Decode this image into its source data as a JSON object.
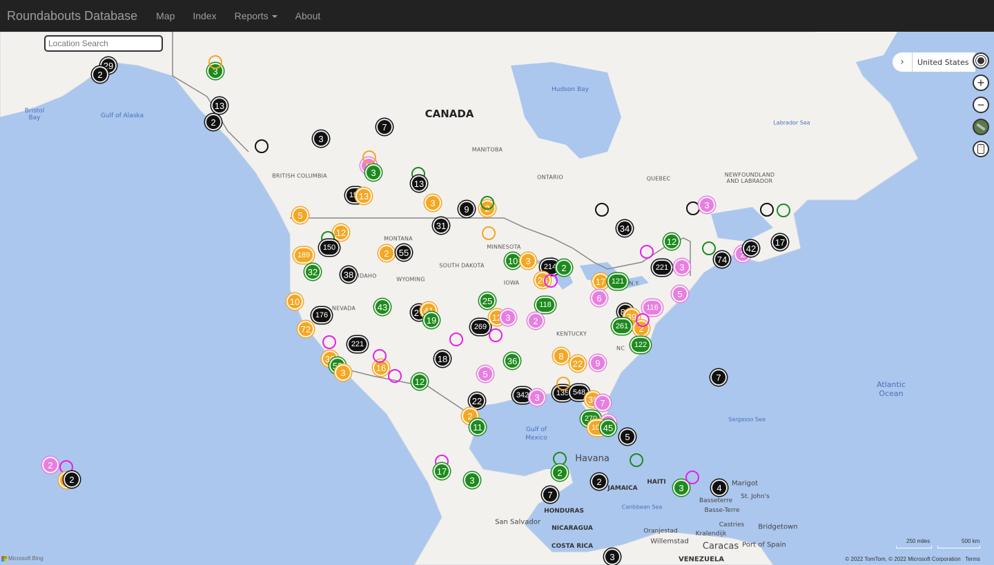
{
  "navbar": {
    "brand": "Roundabouts Database",
    "items": [
      {
        "label": "Map"
      },
      {
        "label": "Index"
      },
      {
        "label": "Reports",
        "has_dropdown": true
      },
      {
        "label": "About"
      }
    ]
  },
  "search": {
    "placeholder": "Location Search",
    "value": ""
  },
  "map_controls": {
    "location_label": "United States",
    "expand_icon": "chevron-right-icon",
    "buttons": [
      "locate-me-icon",
      "zoom-in-icon",
      "zoom-out-icon",
      "map-style-icon",
      "traffic-icon"
    ]
  },
  "map_labels": {
    "countries": [
      "CANADA"
    ],
    "regions": [
      "BRITISH COLUMBIA",
      "MANITOBA",
      "ONTARIO",
      "QUEBEC",
      "NEWFOUNDLAND AND LABRADOR",
      "MONTANA",
      "MINNESOTA",
      "SOUTH DAKOTA",
      "IDAHO",
      "WYOMING",
      "IOWA",
      "NEVADA",
      "KENTUCKY",
      "N.Y.",
      "NC"
    ],
    "water": [
      "Hudson Bay",
      "Gulf of Alaska",
      "Bristol Bay",
      "Labrador Sea",
      "Gulf of Mexico",
      "Caribbean Sea",
      "Sargasso Sea",
      "Atlantic Ocean"
    ],
    "small_countries": [
      "HAITI",
      "JAMAICA",
      "HONDURAS",
      "NICARAGUA",
      "COSTA RICA",
      "VENEZUELA"
    ],
    "cities": [
      "Havana",
      "San Salvador",
      "Marigot",
      "Basseterre",
      "St. John's",
      "Basse-Terre",
      "Castries",
      "Bridgetown",
      "Oranjestad",
      "Kralendijk",
      "Willemstad",
      "Caracas",
      "Port of Spain"
    ]
  },
  "legend_colors": {
    "black": "#111111",
    "green": "#1e8a1e",
    "orange": "#f5a623",
    "pink": "#e77fe0",
    "magenta": "#e81ee8"
  },
  "markers": [
    {
      "count": "29",
      "color": "black"
    },
    {
      "count": "2",
      "color": "black"
    },
    {
      "count": "3",
      "color": "green"
    },
    {
      "count": "",
      "color": "orange",
      "ring": true
    },
    {
      "count": "13",
      "color": "black"
    },
    {
      "count": "2",
      "color": "black"
    },
    {
      "count": "",
      "color": "black",
      "ring": true
    },
    {
      "count": "3",
      "color": "black"
    },
    {
      "count": "7",
      "color": "black"
    },
    {
      "count": "6",
      "color": "pink"
    },
    {
      "count": "3",
      "color": "green"
    },
    {
      "count": "",
      "color": "orange",
      "ring": true
    },
    {
      "count": "",
      "color": "green",
      "ring": true
    },
    {
      "count": "13",
      "color": "black"
    },
    {
      "count": "150",
      "color": "black"
    },
    {
      "count": "13",
      "color": "orange"
    },
    {
      "count": "3",
      "color": "orange"
    },
    {
      "count": "9",
      "color": "black"
    },
    {
      "count": "2",
      "color": "orange"
    },
    {
      "count": "",
      "color": "green",
      "ring": true
    },
    {
      "count": "5",
      "color": "orange"
    },
    {
      "count": "31",
      "color": "black"
    },
    {
      "count": "12",
      "color": "orange"
    },
    {
      "count": "",
      "color": "green",
      "ring": true
    },
    {
      "count": "150",
      "color": "black"
    },
    {
      "count": "",
      "color": "orange",
      "ring": true
    },
    {
      "count": "",
      "color": "black",
      "ring": true
    },
    {
      "count": "34",
      "color": "black"
    },
    {
      "count": "",
      "color": "black",
      "ring": true
    },
    {
      "count": "3",
      "color": "pink"
    },
    {
      "count": "",
      "color": "black",
      "ring": true
    },
    {
      "count": "",
      "color": "green",
      "ring": true
    },
    {
      "count": "189",
      "color": "orange"
    },
    {
      "count": "32",
      "color": "green"
    },
    {
      "count": "38",
      "color": "black"
    },
    {
      "count": "2",
      "color": "orange"
    },
    {
      "count": "55",
      "color": "black"
    },
    {
      "count": "10",
      "color": "green"
    },
    {
      "count": "3",
      "color": "orange"
    },
    {
      "count": "214",
      "color": "black"
    },
    {
      "count": "2",
      "color": "green"
    },
    {
      "count": "26",
      "color": "orange"
    },
    {
      "count": "",
      "color": "magenta",
      "ring": true
    },
    {
      "count": "17",
      "color": "orange"
    },
    {
      "count": "121",
      "color": "green"
    },
    {
      "count": "",
      "color": "magenta",
      "ring": true
    },
    {
      "count": "12",
      "color": "green"
    },
    {
      "count": "",
      "color": "green",
      "ring": true
    },
    {
      "count": "221",
      "color": "black"
    },
    {
      "count": "3",
      "color": "pink"
    },
    {
      "count": "74",
      "color": "black"
    },
    {
      "count": "2",
      "color": "pink"
    },
    {
      "count": "42",
      "color": "black"
    },
    {
      "count": "17",
      "color": "black"
    },
    {
      "count": "10",
      "color": "orange"
    },
    {
      "count": "176",
      "color": "black"
    },
    {
      "count": "43",
      "color": "green"
    },
    {
      "count": "27",
      "color": "black"
    },
    {
      "count": "41",
      "color": "orange"
    },
    {
      "count": "19",
      "color": "green"
    },
    {
      "count": "25",
      "color": "green"
    },
    {
      "count": "118",
      "color": "green"
    },
    {
      "count": "6",
      "color": "pink"
    },
    {
      "count": "116",
      "color": "pink"
    },
    {
      "count": "5",
      "color": "pink"
    },
    {
      "count": "269",
      "color": "black"
    },
    {
      "count": "12",
      "color": "orange"
    },
    {
      "count": "3",
      "color": "pink"
    },
    {
      "count": "2",
      "color": "pink"
    },
    {
      "count": "84",
      "color": "black"
    },
    {
      "count": "39",
      "color": "orange"
    },
    {
      "count": "261",
      "color": "green"
    },
    {
      "count": "2",
      "color": "orange"
    },
    {
      "count": "",
      "color": "magenta",
      "ring": true
    },
    {
      "count": "72",
      "color": "orange"
    },
    {
      "count": "",
      "color": "magenta",
      "ring": true
    },
    {
      "count": "221",
      "color": "black"
    },
    {
      "count": "",
      "color": "magenta",
      "ring": true
    },
    {
      "count": "",
      "color": "magenta",
      "ring": true
    },
    {
      "count": "122",
      "color": "green"
    },
    {
      "count": "36",
      "color": "orange"
    },
    {
      "count": "58",
      "color": "green"
    },
    {
      "count": "3",
      "color": "orange"
    },
    {
      "count": "16",
      "color": "orange"
    },
    {
      "count": "",
      "color": "magenta",
      "ring": true
    },
    {
      "count": "",
      "color": "magenta",
      "ring": true
    },
    {
      "count": "18",
      "color": "black"
    },
    {
      "count": "36",
      "color": "green"
    },
    {
      "count": "5",
      "color": "pink"
    },
    {
      "count": "8",
      "color": "orange"
    },
    {
      "count": "22",
      "color": "orange"
    },
    {
      "count": "9",
      "color": "pink"
    },
    {
      "count": "12",
      "color": "green"
    },
    {
      "count": "22",
      "color": "black"
    },
    {
      "count": "342",
      "color": "black"
    },
    {
      "count": "3",
      "color": "pink"
    },
    {
      "count": "135",
      "color": "black"
    },
    {
      "count": "548",
      "color": "black"
    },
    {
      "count": "",
      "color": "orange",
      "ring": true
    },
    {
      "count": "36",
      "color": "orange"
    },
    {
      "count": "7",
      "color": "pink"
    },
    {
      "count": "7",
      "color": "black"
    },
    {
      "count": "2",
      "color": "orange"
    },
    {
      "count": "11",
      "color": "green"
    },
    {
      "count": "270",
      "color": "green"
    },
    {
      "count": "2",
      "color": "pink"
    },
    {
      "count": "100",
      "color": "orange"
    },
    {
      "count": "45",
      "color": "green"
    },
    {
      "count": "5",
      "color": "black"
    },
    {
      "count": "",
      "color": "magenta",
      "ring": true
    },
    {
      "count": "17",
      "color": "green"
    },
    {
      "count": "3",
      "color": "green"
    },
    {
      "count": "",
      "color": "green",
      "ring": true
    },
    {
      "count": "2",
      "color": "green"
    },
    {
      "count": "",
      "color": "green",
      "ring": true
    },
    {
      "count": "2",
      "color": "black"
    },
    {
      "count": "7",
      "color": "black"
    },
    {
      "count": "3",
      "color": "green"
    },
    {
      "count": "",
      "color": "magenta",
      "ring": true
    },
    {
      "count": "4",
      "color": "black"
    },
    {
      "count": "3",
      "color": "black"
    },
    {
      "count": "2",
      "color": "pink"
    },
    {
      "count": "",
      "color": "magenta",
      "ring": true
    },
    {
      "count": "2",
      "color": "orange"
    },
    {
      "count": "2",
      "color": "black"
    }
  ],
  "scale": {
    "miles": "250 miles",
    "km": "500 km"
  },
  "footer": {
    "copyright": "© 2022 TomTom, © 2022 Microsoft Corporation",
    "terms": "Terms",
    "bing": "Microsoft Bing"
  }
}
